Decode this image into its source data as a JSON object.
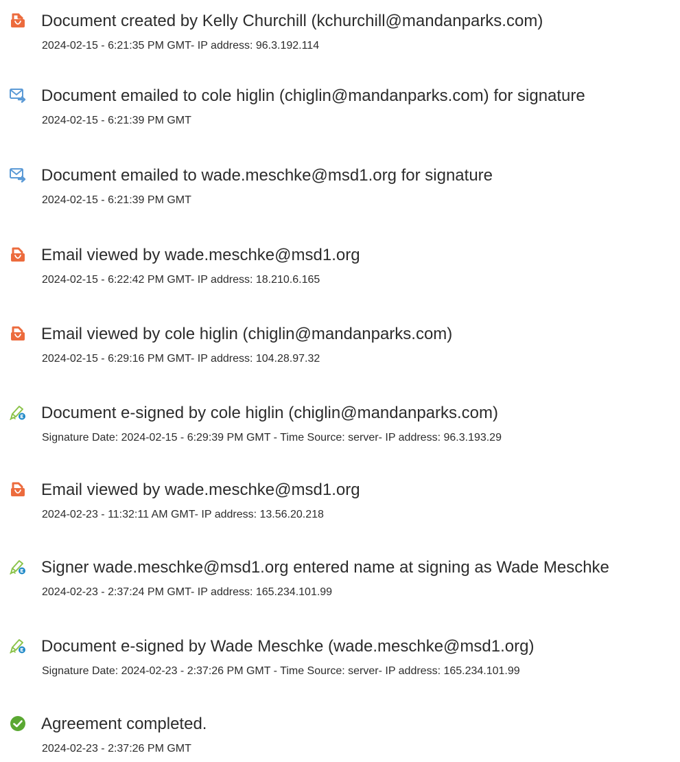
{
  "events": [
    {
      "icon": "document-created-icon",
      "title": "Document created by Kelly Churchill (kchurchill@mandanparks.com)",
      "detail": "2024-02-15 - 6:21:35 PM GMT- IP address: 96.3.192.114"
    },
    {
      "icon": "email-sent-icon",
      "title": "Document emailed to cole higlin (chiglin@mandanparks.com) for signature",
      "detail": "2024-02-15 - 6:21:39 PM GMT"
    },
    {
      "icon": "email-sent-icon",
      "title": "Document emailed to wade.meschke@msd1.org for signature",
      "detail": "2024-02-15 - 6:21:39 PM GMT"
    },
    {
      "icon": "document-viewed-icon",
      "title": "Email viewed by wade.meschke@msd1.org",
      "detail": "2024-02-15 - 6:22:42 PM GMT- IP address: 18.210.6.165"
    },
    {
      "icon": "document-viewed-icon",
      "title": "Email viewed by cole higlin (chiglin@mandanparks.com)",
      "detail": "2024-02-15 - 6:29:16 PM GMT- IP address: 104.28.97.32"
    },
    {
      "icon": "e-sign-pen-icon",
      "title": "Document e-signed by cole higlin (chiglin@mandanparks.com)",
      "detail": "Signature Date: 2024-02-15 - 6:29:39 PM GMT - Time Source: server- IP address: 96.3.193.29"
    },
    {
      "icon": "document-viewed-icon",
      "title": "Email viewed by wade.meschke@msd1.org",
      "detail": "2024-02-23 - 11:32:11 AM GMT- IP address: 13.56.20.218"
    },
    {
      "icon": "e-sign-pen-icon",
      "title": "Signer wade.meschke@msd1.org entered name at signing as Wade Meschke",
      "detail": "2024-02-23 - 2:37:24 PM GMT- IP address: 165.234.101.99"
    },
    {
      "icon": "e-sign-pen-icon",
      "title": "Document e-signed by Wade Meschke (wade.meschke@msd1.org)",
      "detail": "Signature Date: 2024-02-23 - 2:37:26 PM GMT - Time Source: server- IP address: 165.234.101.99"
    },
    {
      "icon": "check-circle-icon",
      "title": "Agreement completed.",
      "detail": "2024-02-23 - 2:37:26 PM GMT"
    }
  ],
  "colors": {
    "document_icon": "#ec6b3d",
    "email_icon": "#5b9ad6",
    "sign_icon_pen": "#8bc34a",
    "sign_icon_badge": "#1e88c7",
    "check_icon": "#5aa832",
    "text": "#2c2c2c"
  }
}
